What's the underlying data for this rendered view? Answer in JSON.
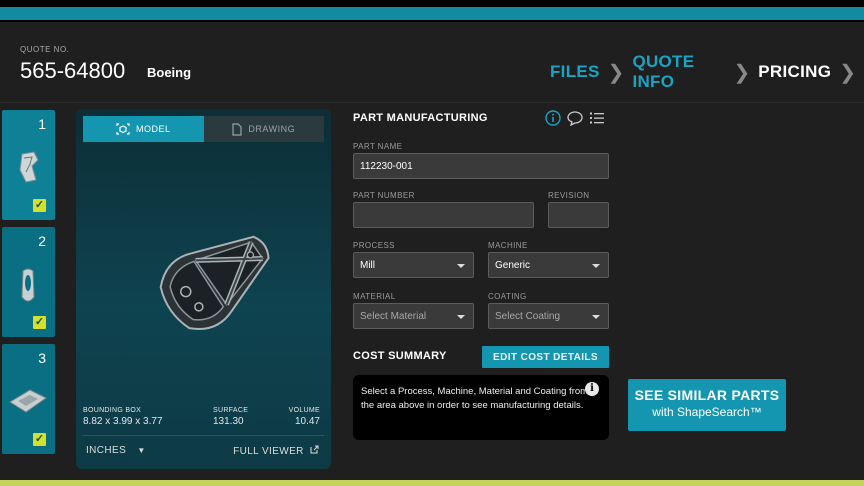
{
  "header": {
    "quote_label": "QUOTE NO.",
    "quote_number": "565-64800",
    "company": "Boeing",
    "nav": [
      {
        "label": "FILES",
        "state": "done"
      },
      {
        "label": "QUOTE INFO",
        "state": "done"
      },
      {
        "label": "PRICING",
        "state": "current"
      }
    ]
  },
  "parts": [
    {
      "number": "1",
      "checked": true
    },
    {
      "number": "2",
      "checked": true
    },
    {
      "number": "3",
      "checked": true
    }
  ],
  "viewer": {
    "tab_model": "MODEL",
    "tab_drawing": "DRAWING",
    "bounding_box_label": "BOUNDING BOX",
    "bounding_box_value": "8.82 x 3.99 x 3.77",
    "surface_label": "SURFACE",
    "surface_value": "131.30",
    "volume_label": "VOLUME",
    "volume_value": "10.47",
    "units": "INCHES",
    "full_viewer": "FULL VIEWER"
  },
  "manufacturing": {
    "title": "PART MANUFACTURING",
    "part_name_label": "PART NAME",
    "part_name_value": "112230-001",
    "part_number_label": "PART NUMBER",
    "part_number_value": "",
    "revision_label": "REVISION",
    "revision_value": "",
    "process_label": "PROCESS",
    "process_value": "Mill",
    "machine_label": "MACHINE",
    "machine_value": "Generic",
    "material_label": "MATERIAL",
    "material_placeholder": "Select Material",
    "coating_label": "COATING",
    "coating_placeholder": "Select Coating"
  },
  "cost_summary": {
    "title": "COST SUMMARY",
    "edit_button": "EDIT COST DETAILS",
    "message": "Select a Process, Machine, Material and Coating from the area above in order to see manufacturing details."
  },
  "similar": {
    "line1": "SEE SIMILAR PARTS",
    "line2": "with ShapeSearch™"
  },
  "colors": {
    "accent": "#1596b0",
    "nav_done": "#1aa3c2",
    "check": "#d6e02c",
    "bottom_bar": "#c6d35a"
  }
}
